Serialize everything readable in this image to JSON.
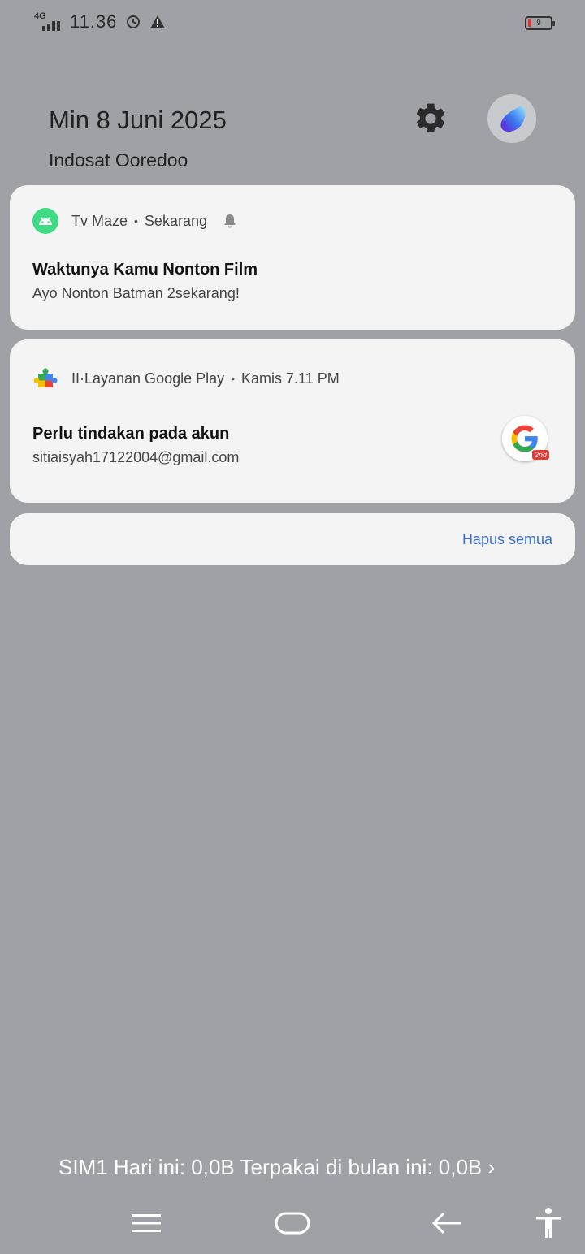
{
  "status_bar": {
    "network": "4G",
    "time": "11.36",
    "battery_level": "9"
  },
  "header": {
    "date": "Min 8 Juni 2025",
    "carrier": "Indosat Ooredoo"
  },
  "notifications": [
    {
      "app": "Tv Maze",
      "time": "Sekarang",
      "title": "Waktunya Kamu Nonton Film",
      "body": "Ayo Nonton Batman 2sekarang!"
    },
    {
      "app": "II·Layanan Google Play",
      "time": "Kamis 7.11 PM",
      "title": "Perlu tindakan pada akun",
      "body": "sitiaisyah17122004@gmail.com",
      "badge": "2nd"
    }
  ],
  "clear_all_label": "Hapus semua",
  "data_usage": "SIM1 Hari ini: 0,0B Terpakai di bulan ini: 0,0B ›",
  "colors": {
    "background": "#a0a1a6",
    "card": "#f4f4f4",
    "accent": "#3b6fd4",
    "android_green": "#3ddc84",
    "battery_low": "#d33"
  }
}
